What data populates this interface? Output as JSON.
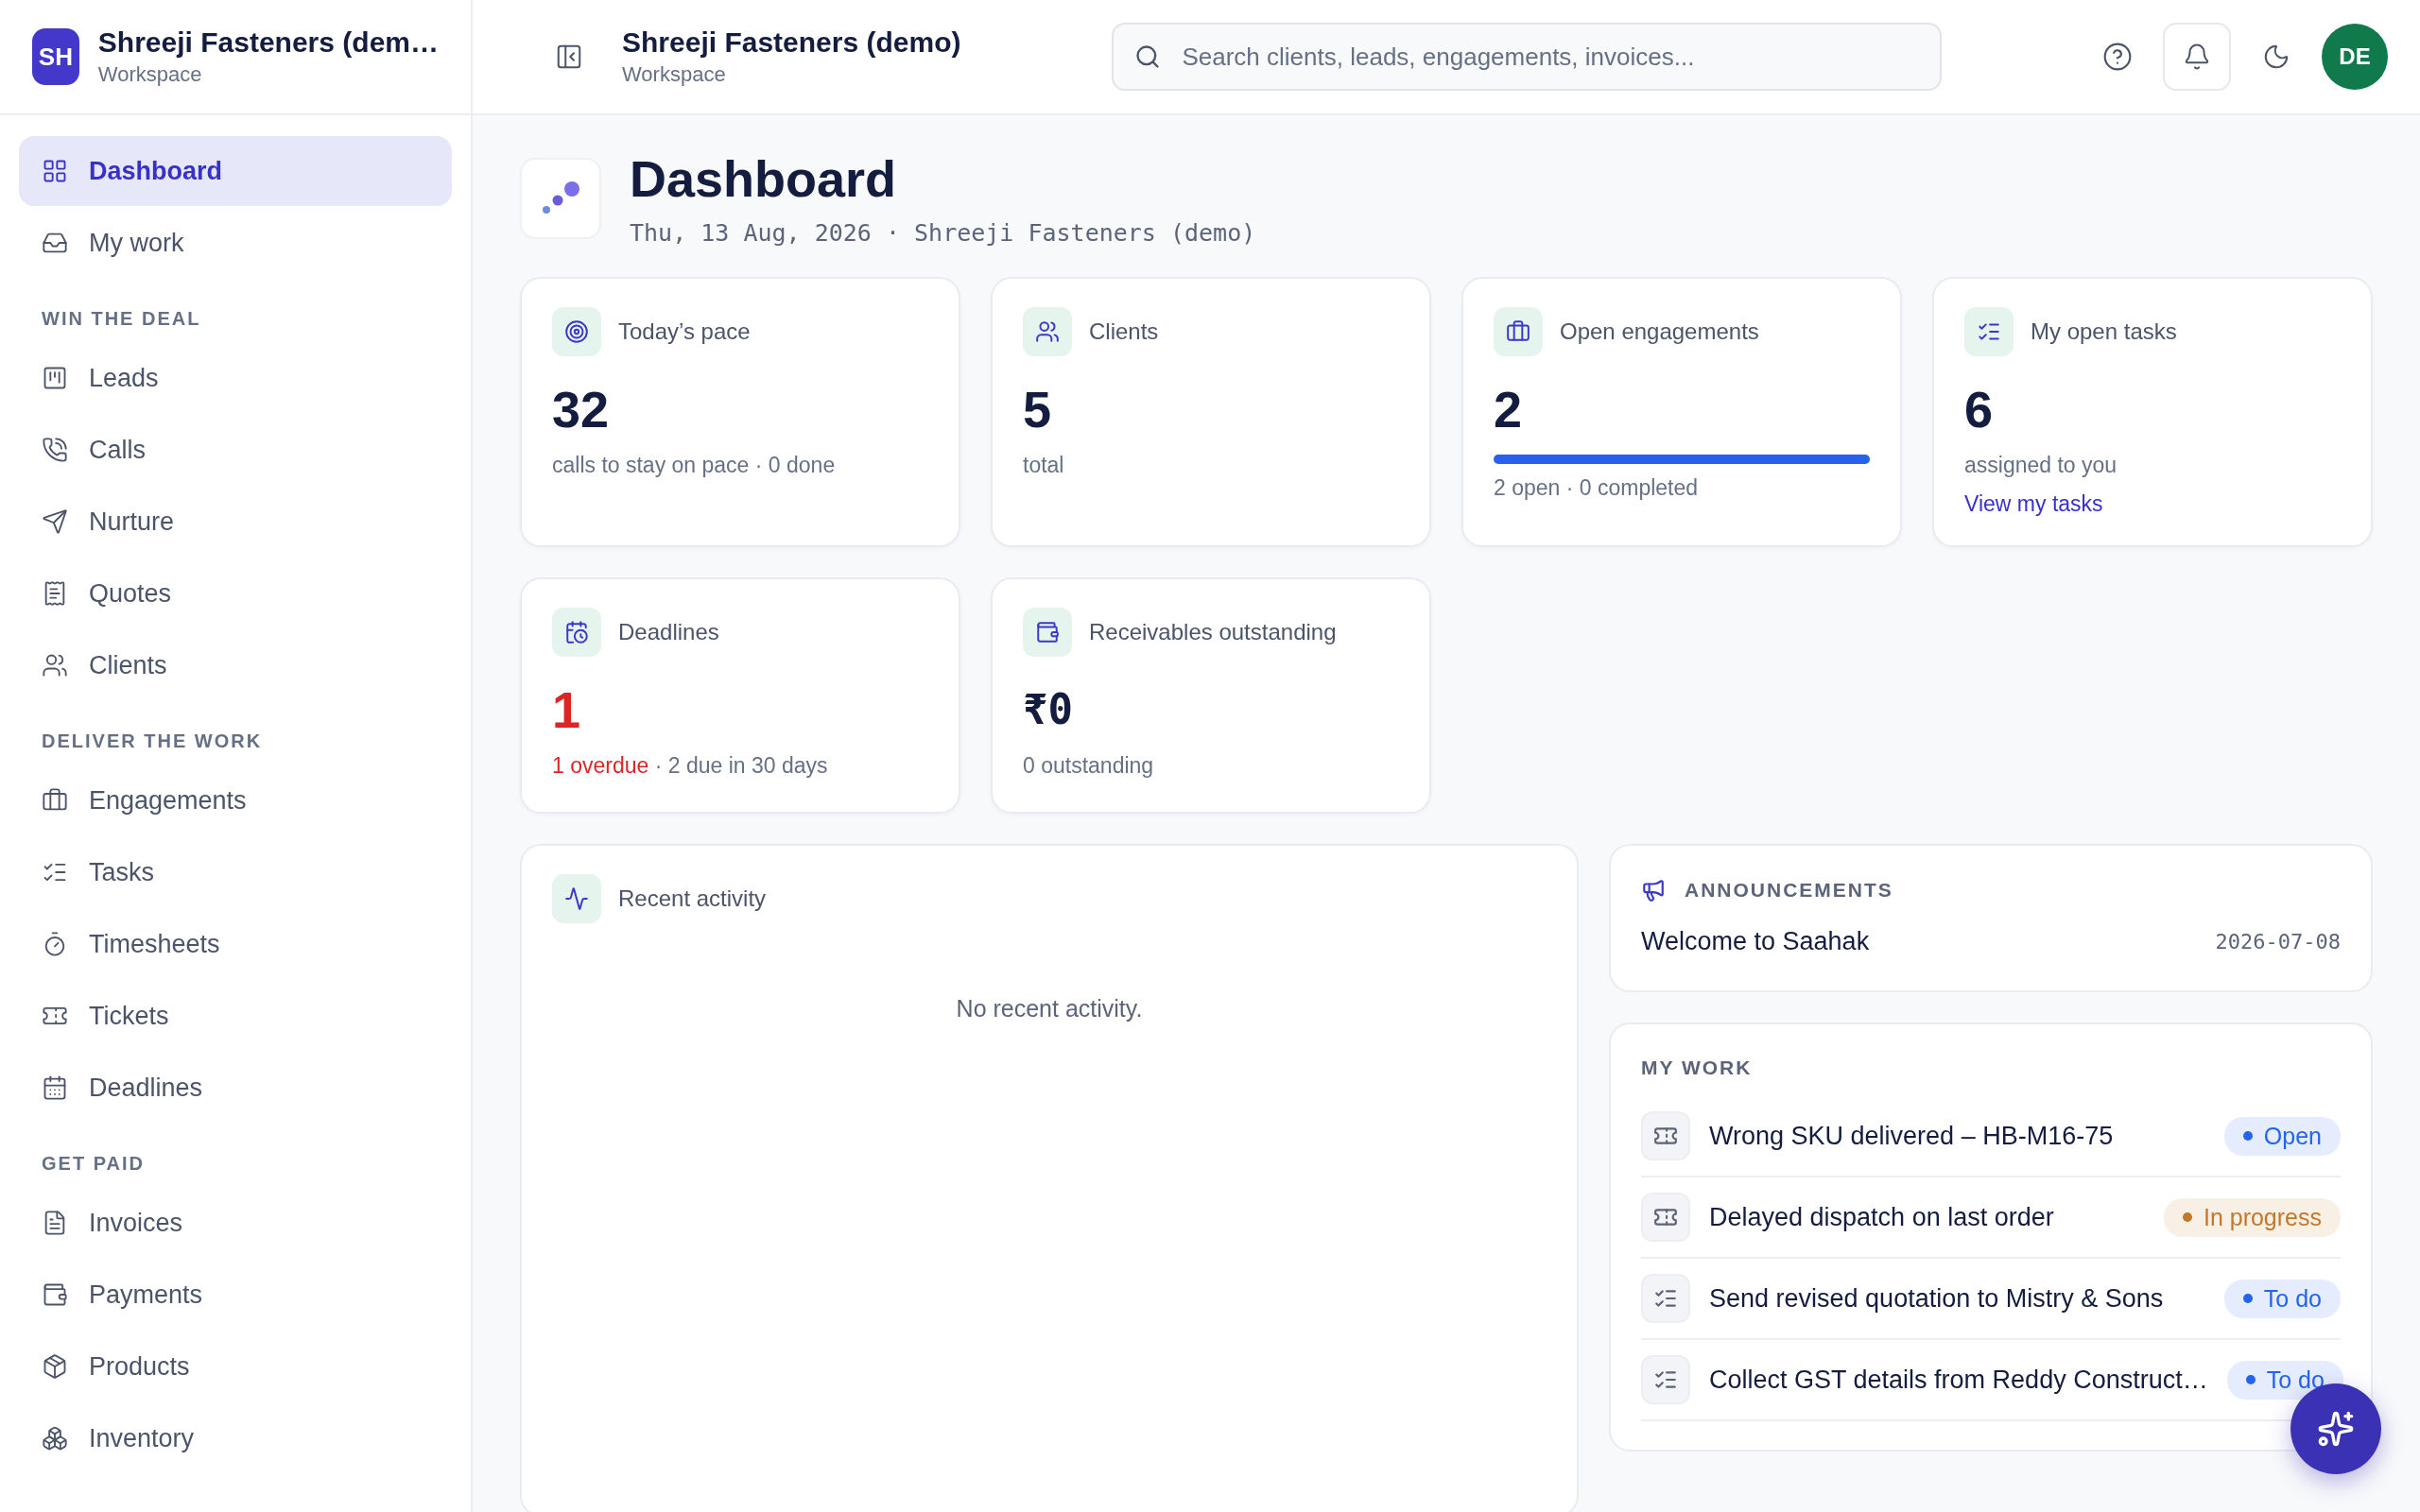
{
  "sidebar": {
    "brand": {
      "initials": "SH",
      "name": "Shreeji Fasteners (dem…",
      "subtitle": "Workspace"
    },
    "sections": [
      {
        "items": [
          {
            "label": "Dashboard",
            "selected": true
          },
          {
            "label": "My work",
            "selected": false
          }
        ]
      },
      {
        "heading": "WIN THE DEAL",
        "items": [
          {
            "label": "Leads",
            "selected": false
          },
          {
            "label": "Calls",
            "selected": false
          },
          {
            "label": "Nurture",
            "selected": false
          },
          {
            "label": "Quotes",
            "selected": false
          },
          {
            "label": "Clients",
            "selected": false
          }
        ]
      },
      {
        "heading": "DELIVER THE WORK",
        "items": [
          {
            "label": "Engagements",
            "selected": false
          },
          {
            "label": "Tasks",
            "selected": false
          },
          {
            "label": "Timesheets",
            "selected": false
          },
          {
            "label": "Tickets",
            "selected": false
          },
          {
            "label": "Deadlines",
            "selected": false
          }
        ]
      },
      {
        "heading": "GET PAID",
        "items": [
          {
            "label": "Invoices",
            "selected": false
          },
          {
            "label": "Payments",
            "selected": false
          },
          {
            "label": "Products",
            "selected": false
          },
          {
            "label": "Inventory",
            "selected": false
          }
        ]
      }
    ]
  },
  "header": {
    "title": "Shreeji Fasteners (demo)",
    "subtitle": "Workspace",
    "search": {
      "placeholder": "Search clients, leads, engagements, invoices..."
    },
    "avatar": "DE"
  },
  "page": {
    "title": "Dashboard",
    "subtitle": "Thu, 13 Aug, 2026 · Shreeji Fasteners (demo)"
  },
  "stat_cards": [
    {
      "label": "Today’s pace",
      "value": "32",
      "note": "calls to stay on pace · 0 done"
    },
    {
      "label": "Clients",
      "value": "5",
      "note": "total"
    },
    {
      "label": "Open engagements",
      "value": "2",
      "level": 1,
      "note": "2 open · 0 completed"
    },
    {
      "label": "My open tasks",
      "value": "6",
      "note": "assigned to you",
      "link": "View my tasks"
    },
    {
      "label": "Deadlines",
      "value": "1",
      "overdue": true,
      "alert": "1 overdue",
      "note": " · 2 due in 30 days"
    },
    {
      "label": "Receivables outstanding",
      "value": "₹0",
      "note": "0 outstanding"
    }
  ],
  "recent_activity": {
    "title": "Recent activity",
    "empty": "No recent activity."
  },
  "announcements": {
    "heading": "ANNOUNCEMENTS",
    "items": [
      {
        "title": "Welcome to Saahak",
        "date": "2026-07-08"
      }
    ]
  },
  "my_work": {
    "heading": "MY WORK",
    "items": [
      {
        "kind": "ticket",
        "title": "Wrong SKU delivered – HB-M16-75",
        "status": "Open",
        "color": "#2563eb"
      },
      {
        "kind": "ticket",
        "title": "Delayed dispatch on last order",
        "status": "In progress",
        "color": "#c2782a"
      },
      {
        "kind": "task",
        "title": "Send revised quotation to Mistry & Sons",
        "status": "To do",
        "color": "#2563eb"
      },
      {
        "kind": "task",
        "title": "Collect GST details from Reddy Construct…",
        "status": "To do",
        "color": "#2563eb"
      }
    ]
  }
}
